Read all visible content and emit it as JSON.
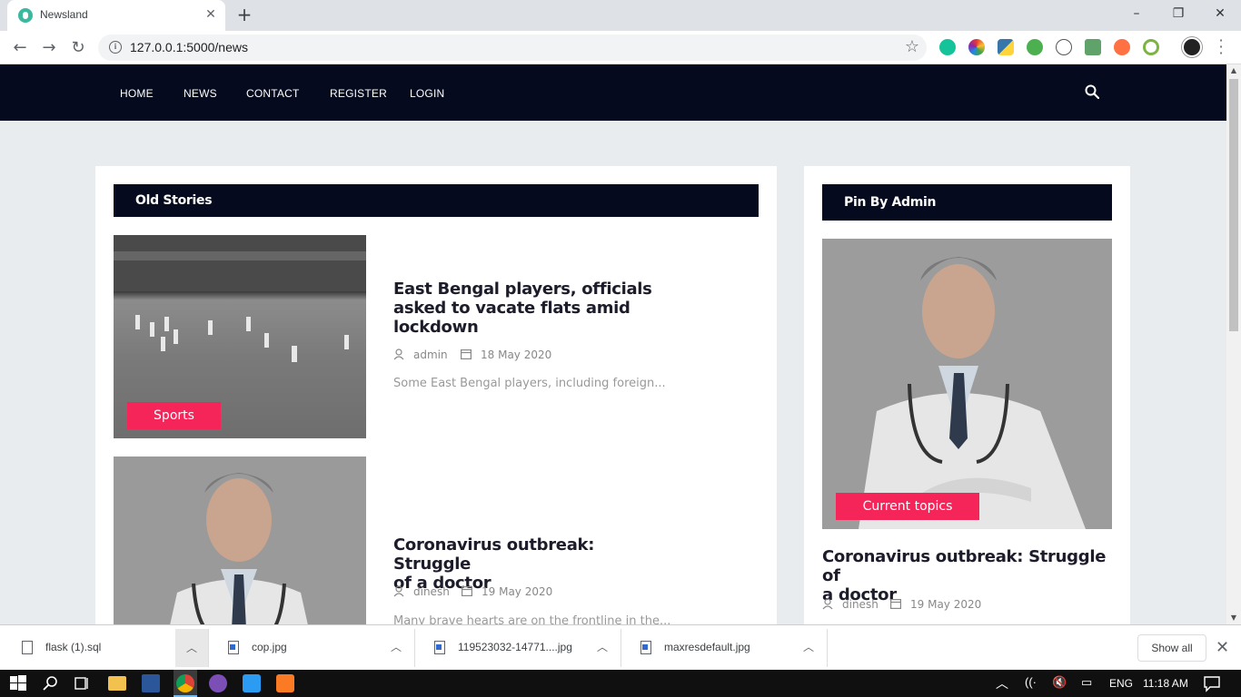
{
  "browser": {
    "tab_title": "Newsland",
    "url": "127.0.0.1:5000/news"
  },
  "site_nav": {
    "links": [
      "HOME",
      "NEWS",
      "CONTACT",
      "REGISTER",
      "LOGIN"
    ]
  },
  "old_stories": {
    "heading": "Old Stories",
    "posts": [
      {
        "category": "Sports",
        "title_lines": [
          "East Bengal players, officials",
          "asked to vacate flats amid",
          "lockdown"
        ],
        "author": "admin",
        "date": "18 May 2020",
        "excerpt": "Some East Bengal players, including foreign..."
      },
      {
        "title_lines": [
          "Coronavirus outbreak: Struggle",
          "of a doctor"
        ],
        "author": "dinesh",
        "date": "19 May 2020",
        "excerpt": "Many brave hearts are on the frontline in the..."
      }
    ]
  },
  "pinned": {
    "heading": "Pin By Admin",
    "category": "Current topics",
    "title_lines": [
      "Coronavirus outbreak: Struggle of",
      "a doctor"
    ],
    "author": "dinesh",
    "date": "19 May 2020"
  },
  "downloads": {
    "items": [
      "flask (1).sql",
      "cop.jpg",
      "119523032-14771....jpg",
      "maxresdefault.jpg"
    ],
    "show_all": "Show all"
  },
  "taskbar": {
    "language": "ENG",
    "time": "11:18 AM"
  },
  "colors": {
    "nav_bg": "#050a1e",
    "accent": "#f5255a"
  }
}
